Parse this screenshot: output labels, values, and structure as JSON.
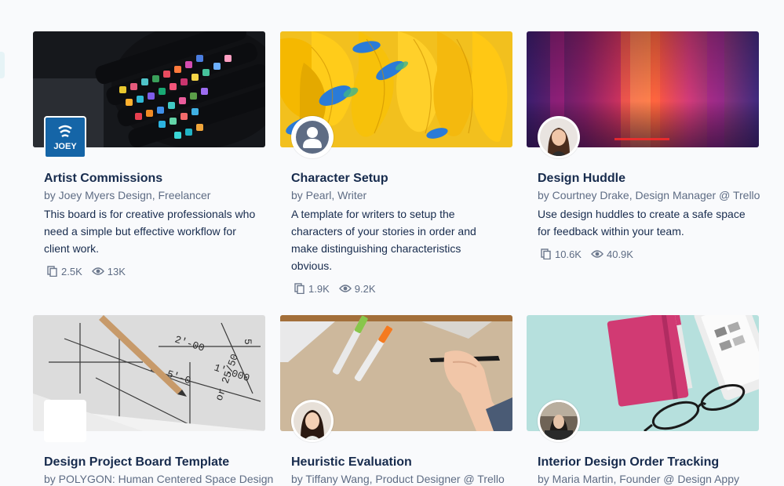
{
  "cards": [
    {
      "title": "Artist Commissions",
      "byline": "by Joey Myers Design, Freelancer",
      "description": "This board is for creative professionals who need a simple but effective workflow for client work.",
      "copies": "2.5K",
      "views": "13K",
      "badge_text": "JOEY",
      "badge_color": "#1565a7"
    },
    {
      "title": "Character Setup",
      "byline": "by Pearl, Writer",
      "description": "A template for writers to setup the characters of your stories in order and make distinguishing characteristics obvious.",
      "copies": "1.9K",
      "views": "9.2K"
    },
    {
      "title": "Design Huddle",
      "byline": "by Courtney Drake, Design Manager @ Trello",
      "description": "Use design huddles to create a safe space for feedback within your team.",
      "copies": "10.6K",
      "views": "40.9K"
    },
    {
      "title": "Design Project Board Template",
      "byline": "by POLYGON: Human Centered Space Design"
    },
    {
      "title": "Heuristic Evaluation",
      "byline": "by Tiffany Wang, Product Designer @ Trello"
    },
    {
      "title": "Interior Design Order Tracking",
      "byline": "by Maria Martin, Founder @ Design Appy"
    }
  ],
  "colors": {
    "title": "#172b4d",
    "muted": "#5e6c84",
    "background": "#f9fafc"
  },
  "icons": {
    "copies": "copy-icon",
    "views": "eye-icon"
  }
}
